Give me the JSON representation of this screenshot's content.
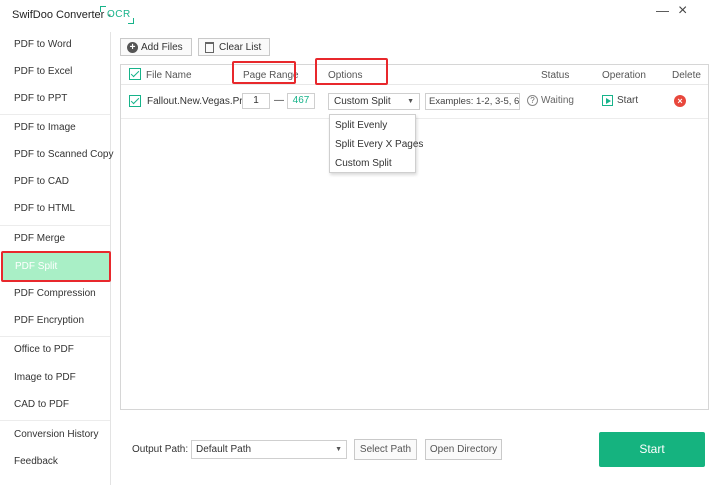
{
  "window": {
    "title": "SwifDoo Converter -",
    "ocr_label": "OCR",
    "minimize_glyph": "—",
    "close_glyph": "×"
  },
  "sidebar": {
    "items": [
      {
        "label": "PDF to Word"
      },
      {
        "label": "PDF to Excel"
      },
      {
        "label": "PDF to PPT"
      },
      {
        "label": "PDF to Image"
      },
      {
        "label": "PDF to Scanned Copy"
      },
      {
        "label": "PDF to CAD"
      },
      {
        "label": "PDF to HTML"
      },
      {
        "label": "PDF Merge"
      },
      {
        "label": "PDF Split",
        "active": true
      },
      {
        "label": "PDF Compression"
      },
      {
        "label": "PDF Encryption"
      },
      {
        "label": "Office to PDF"
      },
      {
        "label": "Image to PDF"
      },
      {
        "label": "CAD to PDF"
      },
      {
        "label": "Conversion History"
      },
      {
        "label": "Feedback"
      }
    ]
  },
  "toolbar": {
    "add_files": "Add Files",
    "clear_list": "Clear List"
  },
  "table": {
    "headers": {
      "file_name": "File Name",
      "page_range": "Page Range",
      "options": "Options",
      "status": "Status",
      "operation": "Operation",
      "delete": "Delete"
    },
    "rows": [
      {
        "file_name": "Fallout.New.Vegas.Pr...",
        "page_from": "1",
        "page_sep": "—",
        "page_to": "467",
        "option": "Custom Split",
        "examples": "Examples: 1-2, 3-5, 6",
        "status": "Waiting",
        "operation": "Start",
        "delete_glyph": "×"
      }
    ]
  },
  "options_dropdown": [
    "Split Evenly",
    "Split Every X Pages",
    "Custom Split"
  ],
  "footer": {
    "output_label": "Output Path:",
    "output_value": "Default Path",
    "select_path": "Select Path",
    "open_directory": "Open Directory",
    "start": "Start"
  },
  "colors": {
    "accent": "#15b37f",
    "highlight": "#e8282c",
    "active_bg": "#a9efc6",
    "delete": "#e8473c"
  }
}
